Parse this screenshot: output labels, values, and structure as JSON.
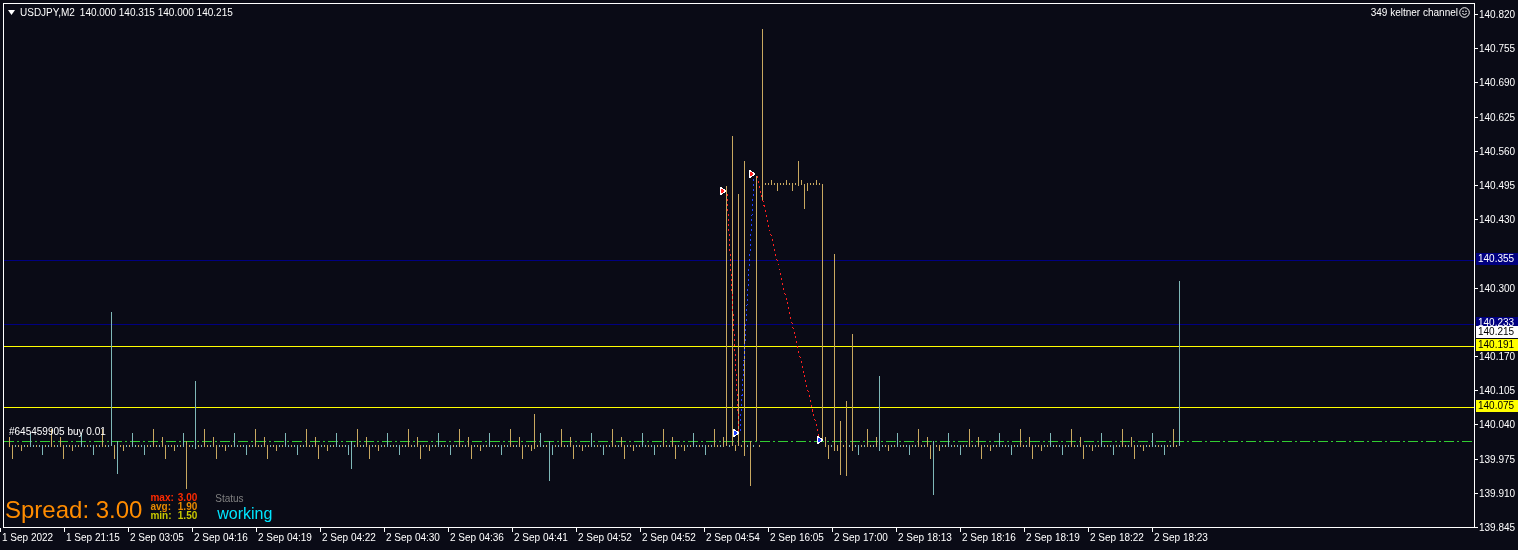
{
  "symbol_bar": {
    "symbol": "USDJPY,M2",
    "ohlc": "140.000 140.315 140.000 140.215"
  },
  "indicator": {
    "label": "349 keltner channel"
  },
  "price_axis": {
    "labels": [
      "140.820",
      "140.755",
      "140.690",
      "140.625",
      "140.560",
      "140.495",
      "140.430",
      "140.300",
      "140.170",
      "140.105",
      "140.040",
      "139.975",
      "139.910",
      "139.845"
    ]
  },
  "price_lines": [
    {
      "tag": "140.355",
      "color": "#000080",
      "kind": "line"
    },
    {
      "tag": "140.233",
      "color": "#000080",
      "kind": "line"
    },
    {
      "tag": "140.215",
      "color": "#ffffff",
      "kind": "tag"
    },
    {
      "tag": "140.191",
      "color": "#ffff00",
      "kind": "line"
    },
    {
      "tag": "140.075",
      "color": "#ffff00",
      "kind": "line"
    }
  ],
  "order": {
    "label": "#645459905 buy 0.01",
    "color": "#32cd32"
  },
  "spread": {
    "label": "Spread: 3.00",
    "stats": [
      {
        "label": "max:",
        "value": "3.00",
        "color": "#ff2a00"
      },
      {
        "label": "avg:",
        "value": "1.90",
        "color": "#e88a00"
      },
      {
        "label": "min:",
        "value": "1.50",
        "color": "#c8c800"
      }
    ],
    "status_title": "Status",
    "status": "working"
  },
  "time_axis": {
    "labels": [
      "1 Sep 2022",
      "1 Sep 21:15",
      "2 Sep 03:05",
      "2 Sep 04:16",
      "2 Sep 04:19",
      "2 Sep 04:22",
      "2 Sep 04:30",
      "2 Sep 04:36",
      "2 Sep 04:41",
      "2 Sep 04:52",
      "2 Sep 04:52",
      "2 Sep 04:54",
      "2 Sep 16:05",
      "2 Sep 17:00",
      "2 Sep 18:13",
      "2 Sep 18:16",
      "2 Sep 18:19",
      "2 Sep 18:22",
      "2 Sep 18:23"
    ]
  }
}
